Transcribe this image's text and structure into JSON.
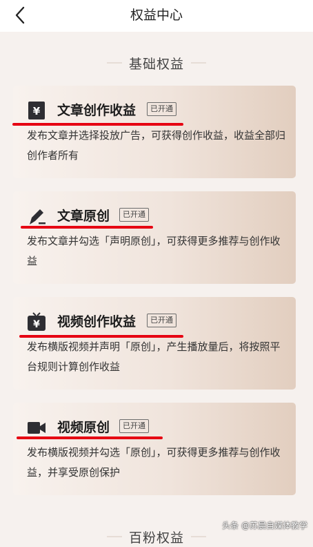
{
  "header": {
    "title": "权益中心",
    "back_icon": "chevron-left-icon"
  },
  "sections": [
    {
      "title": "基础权益"
    },
    {
      "title": "百粉权益"
    }
  ],
  "cards": [
    {
      "icon": "yen-note-icon",
      "title": "文章创作收益",
      "badge": "已开通",
      "desc": "发布文章并选择投放广告，可获得创作收益，收益全部归创作者所有"
    },
    {
      "icon": "pen-icon",
      "title": "文章原创",
      "badge": "已开通",
      "desc": "发布文章并勾选「声明原创」，可获得更多推荐与创作收益"
    },
    {
      "icon": "tv-yen-icon",
      "title": "视频创作收益",
      "badge": "已开通",
      "desc": "发布横版视频并声明「原创」，产生播放量后，将按照平台规则计算创作收益"
    },
    {
      "icon": "video-camera-icon",
      "title": "视频原创",
      "badge": "已开通",
      "desc": "发布横版视频并勾选「原创」，可获得更多推荐与创作收益，并享受原创保护"
    }
  ],
  "watermark": "头条 @苏晨自媒体教学",
  "colors": {
    "background": "#f6f1ee",
    "underline": "#e60012"
  }
}
